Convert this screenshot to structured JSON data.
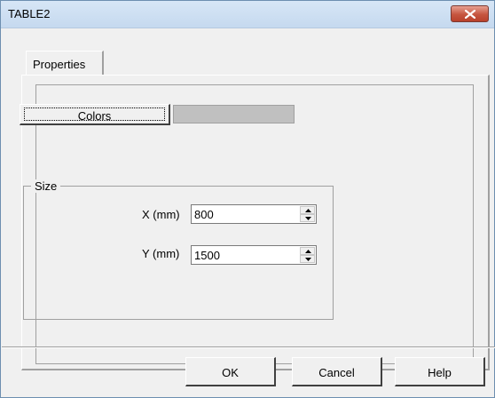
{
  "window": {
    "title": "TABLE2"
  },
  "tabs": [
    {
      "label": "Properties",
      "selected": true
    }
  ],
  "colors": {
    "button_label": "Colors",
    "swatch_color": "#c0c0c0"
  },
  "size_group": {
    "legend": "Size",
    "x": {
      "label": "X (mm)",
      "value": "800"
    },
    "y": {
      "label": "Y (mm)",
      "value": "1500"
    }
  },
  "buttons": {
    "ok": "OK",
    "cancel": "Cancel",
    "help": "Help"
  },
  "icons": {
    "close": "close-icon",
    "spin_up": "spin-up-arrow-icon",
    "spin_down": "spin-down-arrow-icon"
  }
}
